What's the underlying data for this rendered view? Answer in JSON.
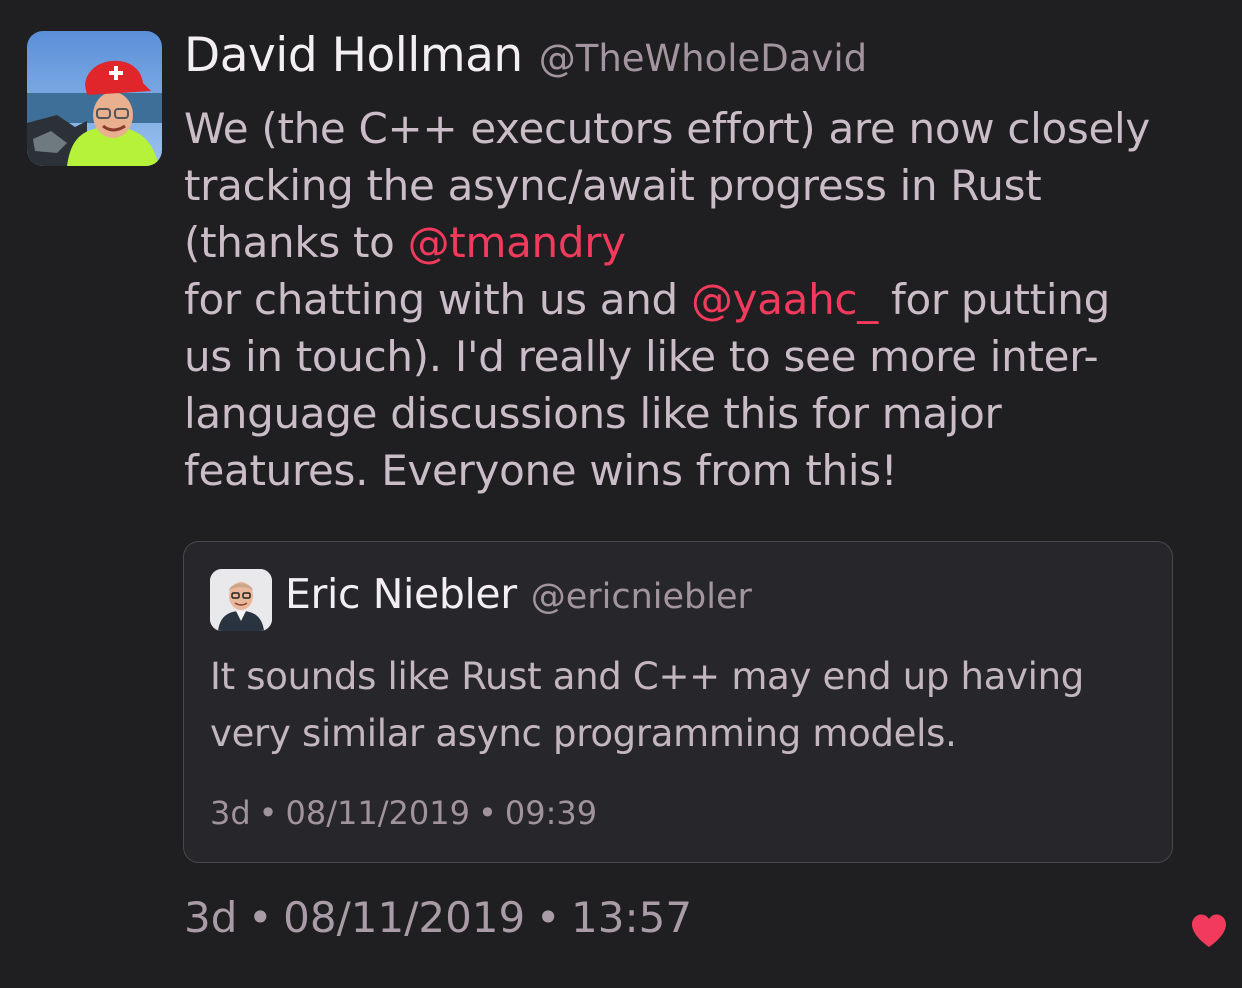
{
  "tweet": {
    "author_name": "David Hollman",
    "author_handle": "@TheWholeDavid",
    "text_lines": [
      [
        {
          "t": "We (the C++ executors effort) are now closely"
        }
      ],
      [
        {
          "t": "tracking the async/await progress in Rust"
        }
      ],
      [
        {
          "t": "(thanks to "
        },
        {
          "t": "@tmandry",
          "mention": true
        }
      ],
      [
        {
          "t": " for chatting with us and "
        },
        {
          "t": "@yaahc_",
          "mention": true
        },
        {
          "t": " for putting"
        }
      ],
      [
        {
          "t": "us in touch). I'd really like to see more inter-"
        }
      ],
      [
        {
          "t": "language discussions like this for major"
        }
      ],
      [
        {
          "t": "features. Everyone wins from this!"
        }
      ]
    ],
    "meta": {
      "relative": "3d",
      "date": "08/11/2019",
      "time": "13:57",
      "separator": "•"
    }
  },
  "quote": {
    "author_name": "Eric Niebler",
    "author_handle": "@ericniebler",
    "text_lines": [
      "It sounds like Rust and C++ may end up having",
      "very similar async programming models."
    ],
    "meta": {
      "relative": "3d",
      "date": "08/11/2019",
      "time": "09:39",
      "separator": "•"
    }
  },
  "icons": {
    "like": "heart-icon"
  },
  "colors": {
    "background": "#1f1e21",
    "mention": "#f23a5c",
    "like": "#f23a5c",
    "card_border": "#4a4750"
  }
}
